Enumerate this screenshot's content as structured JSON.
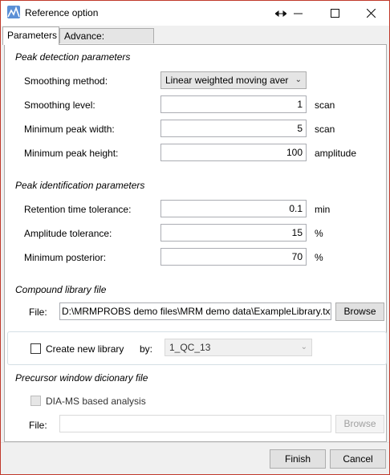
{
  "window": {
    "title": "Reference option",
    "icon": "app-icon",
    "controls": [
      "resize-arrows-icon",
      "minimize-icon",
      "maximize-icon",
      "close-icon"
    ]
  },
  "tabs": [
    {
      "label": "Parameters",
      "active": true
    },
    {
      "label": "Advance: MRMDIFF",
      "active": false
    }
  ],
  "peak_detection": {
    "header": "Peak detection parameters",
    "smoothing_method": {
      "label": "Smoothing method:",
      "value": "Linear weighted moving aver"
    },
    "smoothing_level": {
      "label": "Smoothing level:",
      "value": "1",
      "unit": "scan"
    },
    "min_peak_width": {
      "label": "Minimum peak width:",
      "value": "5",
      "unit": "scan"
    },
    "min_peak_height": {
      "label": "Minimum peak height:",
      "value": "100",
      "unit": "amplitude"
    }
  },
  "peak_identification": {
    "header": "Peak identification parameters",
    "rt_tolerance": {
      "label": "Retention time tolerance:",
      "value": "0.1",
      "unit": "min"
    },
    "amp_tolerance": {
      "label": "Amplitude tolerance:",
      "value": "15",
      "unit": "%"
    },
    "min_posterior": {
      "label": "Minimum posterior:",
      "value": "70",
      "unit": "%"
    }
  },
  "compound_library": {
    "header": "Compound library file",
    "file_label": "File:",
    "file_value": "D:\\MRMPROBS demo files\\MRM demo data\\ExampleLibrary.txt",
    "browse_label": "Browse"
  },
  "new_library": {
    "checkbox_label": "Create new library",
    "checked": false,
    "by_label": "by:",
    "by_value": "1_QC_13"
  },
  "precursor_window": {
    "header": "Precursor window dicionary file",
    "dia_label": "DIA-MS based analysis",
    "dia_checked": false,
    "file_label": "File:",
    "file_value": "",
    "browse_label": "Browse"
  },
  "footer": {
    "finish_label": "Finish",
    "cancel_label": "Cancel"
  }
}
